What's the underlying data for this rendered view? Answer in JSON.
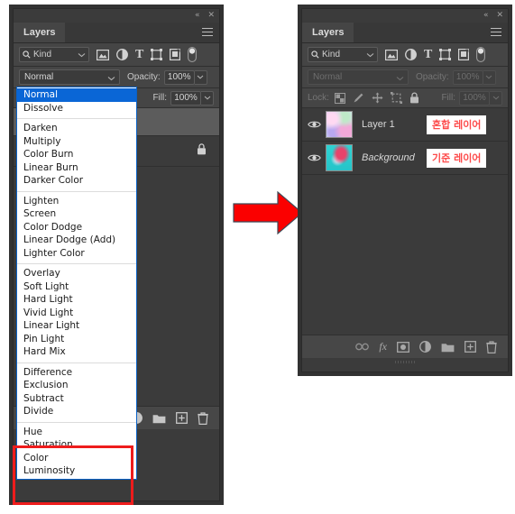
{
  "app": {
    "title": "Photoshop Layers Panel",
    "tab_label": "Layers"
  },
  "titlebar": {
    "collapse_icon": "double-chevron-left-icon",
    "collapse_glyph": "«",
    "close_icon": "close-icon",
    "close_glyph": "✕"
  },
  "filter": {
    "kind_label": "Kind",
    "search_icon": "search-icon",
    "chevron_icon": "chevron-down-icon",
    "icons": [
      {
        "name": "pixel-layer-filter-icon",
        "title": "Pixel layers"
      },
      {
        "name": "adjustment-layer-filter-icon",
        "title": "Adjustment layers"
      },
      {
        "name": "type-layer-filter-icon",
        "title": "Type layers",
        "glyph": "T"
      },
      {
        "name": "shape-layer-filter-icon",
        "title": "Shape layers"
      },
      {
        "name": "smart-object-filter-icon",
        "title": "Smart objects"
      },
      {
        "name": "filter-toggle-switch-icon",
        "title": "Turn filtering on/off"
      }
    ]
  },
  "blend_row": {
    "mode_value": "Normal",
    "opacity_label": "Opacity:",
    "opacity_value": "100%"
  },
  "lock_row": {
    "lock_label": "Lock:",
    "fill_label": "Fill:",
    "fill_value": "100%",
    "lock_icons": [
      {
        "name": "lock-transparent-pixels-icon"
      },
      {
        "name": "lock-image-pixels-icon"
      },
      {
        "name": "lock-position-icon"
      },
      {
        "name": "lock-artboard-nesting-icon"
      },
      {
        "name": "lock-all-icon"
      }
    ]
  },
  "layers": [
    {
      "name": "Layer 1",
      "italic": false,
      "visible": true,
      "thumb": "blend-layer-thumbnail",
      "badge": "혼합 레이어",
      "locked": false
    },
    {
      "name": "Background",
      "italic": true,
      "visible": true,
      "thumb": "background-layer-thumbnail",
      "badge": "기준 레이어",
      "locked": true
    }
  ],
  "left_panel": {
    "hidden_layer_lock_icon": "lock-icon"
  },
  "bottom_toolbar": [
    {
      "name": "link-layers-button",
      "glyph": "∞",
      "label": "Link layers"
    },
    {
      "name": "layer-style-button",
      "glyph": "fx",
      "label": "Add a layer style"
    },
    {
      "name": "layer-mask-button",
      "glyph": "",
      "label": "Add layer mask"
    },
    {
      "name": "adjustment-layer-button",
      "glyph": "",
      "label": "New adjustment layer"
    },
    {
      "name": "new-group-button",
      "glyph": "",
      "label": "Create a new group"
    },
    {
      "name": "new-layer-button",
      "glyph": "+",
      "label": "Create a new layer"
    },
    {
      "name": "delete-layer-button",
      "glyph": "",
      "label": "Delete layer"
    }
  ],
  "blend_mode_menu": {
    "selected": "Normal",
    "groups": [
      [
        "Normal",
        "Dissolve"
      ],
      [
        "Darken",
        "Multiply",
        "Color Burn",
        "Linear Burn",
        "Darker Color"
      ],
      [
        "Lighten",
        "Screen",
        "Color Dodge",
        "Linear Dodge (Add)",
        "Lighter Color"
      ],
      [
        "Overlay",
        "Soft Light",
        "Hard Light",
        "Vivid Light",
        "Linear Light",
        "Pin Light",
        "Hard Mix"
      ],
      [
        "Difference",
        "Exclusion",
        "Subtract",
        "Divide"
      ],
      [
        "Hue",
        "Saturation",
        "Color",
        "Luminosity"
      ]
    ]
  },
  "annotations": {
    "highlight_color": "#ee1c1c",
    "arrow_color": "#fb0000",
    "arrow_name": "red-right-arrow",
    "highlighted_group_name": "component-blend-modes-highlight"
  }
}
